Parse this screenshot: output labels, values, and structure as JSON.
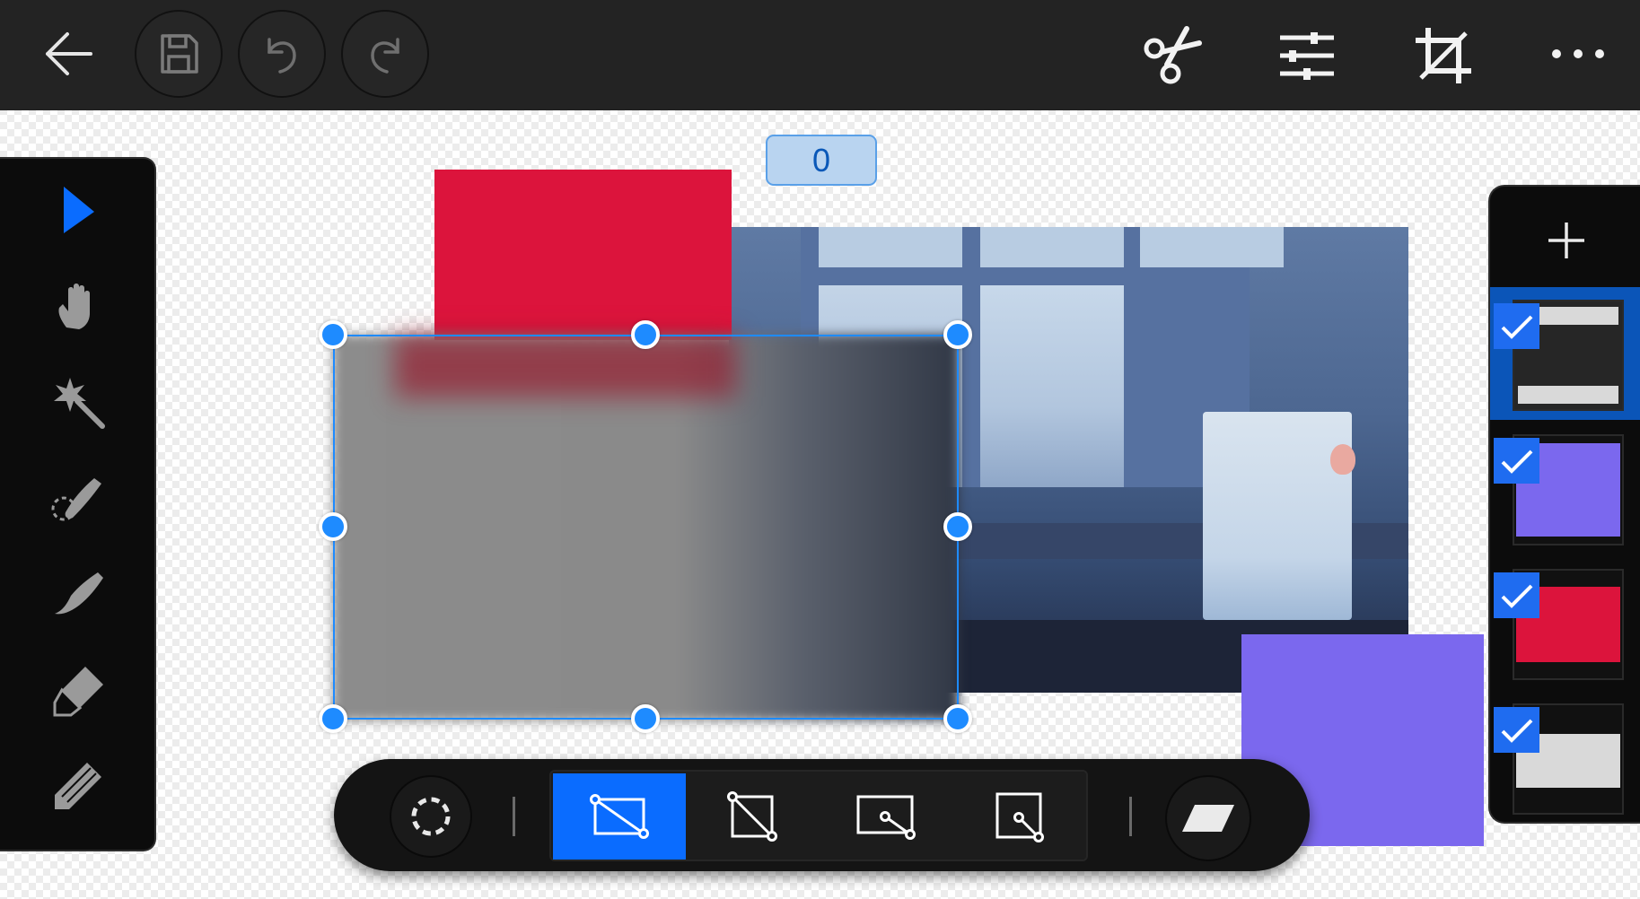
{
  "toolbar": {
    "back_icon": "arrow-left-icon",
    "save_icon": "floppy-disk-icon",
    "undo_icon": "undo-icon",
    "redo_icon": "redo-icon",
    "cut_icon": "scissors-icon",
    "adjust_icon": "sliders-icon",
    "crop_icon": "crop-icon",
    "more_icon": "more-horizontal-icon"
  },
  "rotation_badge": {
    "value": "0"
  },
  "left_tools": [
    {
      "name": "select",
      "icon": "arrow-cursor-icon",
      "active": true
    },
    {
      "name": "pan",
      "icon": "hand-icon"
    },
    {
      "name": "magic-wand",
      "icon": "magic-wand-icon"
    },
    {
      "name": "brush-select",
      "icon": "brush-select-icon"
    },
    {
      "name": "brush",
      "icon": "brush-icon"
    },
    {
      "name": "eraser",
      "icon": "eraser-icon"
    },
    {
      "name": "pencil",
      "icon": "pencil-icon"
    }
  ],
  "layers_panel": {
    "add_icon": "plus-icon",
    "layers": [
      {
        "name": "layer-1",
        "checked": true,
        "selected": true,
        "thumb": "dark-with-bars"
      },
      {
        "name": "layer-2",
        "checked": true,
        "thumb_color": "#7b68ee"
      },
      {
        "name": "layer-3",
        "checked": true,
        "thumb_color": "#dc143c"
      },
      {
        "name": "layer-4",
        "checked": true,
        "thumb_color": "#d9d9d9"
      }
    ]
  },
  "canvas": {
    "red_rect_color": "#dc143c",
    "purple_rect_color": "#7b68ee",
    "selection_color": "#1e8bff"
  },
  "transform_bar": {
    "rotate_icon": "rotate-dashed-circle-icon",
    "modes": [
      {
        "name": "transform-free",
        "icon": "rect-diagonal-icon",
        "active": true
      },
      {
        "name": "transform-distort",
        "icon": "square-diagonal-icon"
      },
      {
        "name": "transform-skew",
        "icon": "rect-handle-icon"
      },
      {
        "name": "transform-perspective",
        "icon": "square-handle-icon"
      }
    ],
    "flip_icon": "parallelogram-icon"
  },
  "accent_color": "#0a6cff"
}
